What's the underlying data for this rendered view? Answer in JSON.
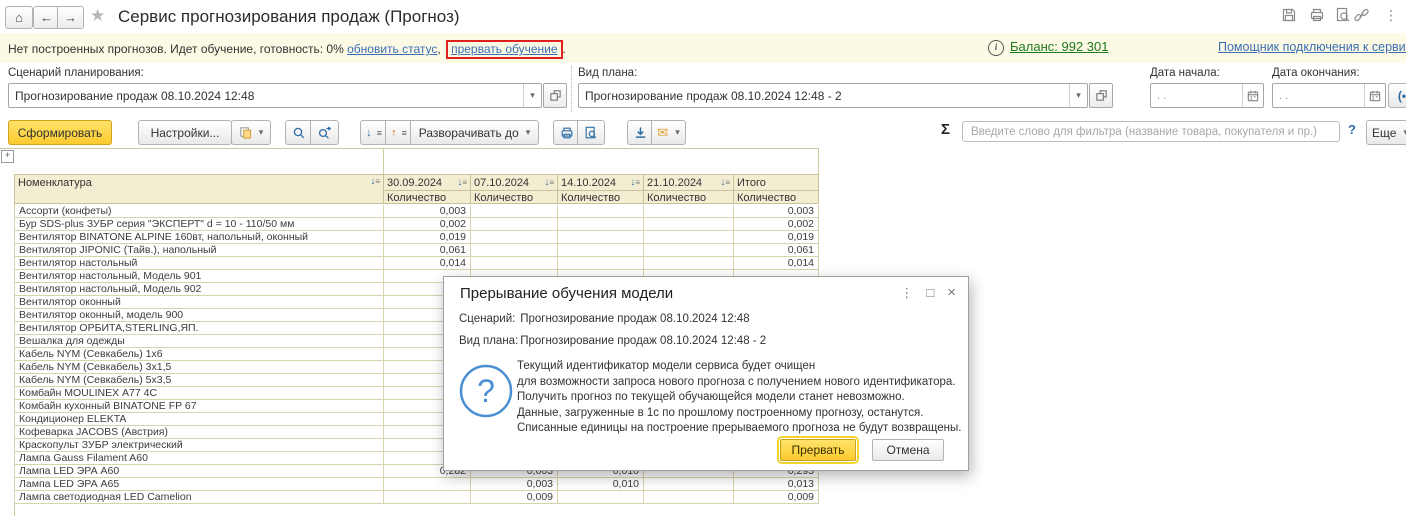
{
  "topbar": {
    "title": "Сервис прогнозирования продаж (Прогноз)"
  },
  "icons": {
    "home": "⌂",
    "back": "←",
    "forward": "→",
    "favorite_star": "★",
    "menu_kebab": "⋮",
    "window_maximize": "□",
    "window_close": "×",
    "dropdown": "▾",
    "sigma": "Σ",
    "info": "i",
    "sort_arrow": "↓",
    "sort_lines": "≡",
    "collapse_arrow": "↓",
    "expand_arrow": "↑",
    "corner_plus": "+",
    "period": "(•)",
    "envelope": "✉"
  },
  "notification": {
    "status_text": "Нет построенных прогнозов. Идет обучение, готовность: 0%",
    "refresh_link": "обновить статус",
    "comma": ",",
    "interrupt_link": "прервать обучение",
    "dot": ".",
    "balance_link": "Баланс: 992 301",
    "assistant_link": "Помощник подключения к сервису"
  },
  "filters": {
    "scenario_label": "Сценарий планирования:",
    "scenario_value": "Прогнозирование продаж 08.10.2024 12:48",
    "plan_label": "Вид плана:",
    "plan_value": "Прогнозирование продаж 08.10.2024 12:48 - 2",
    "date_start_label": "Дата начала:",
    "date_end_label": "Дата окончания:",
    "date_empty_value": ". ."
  },
  "toolbar": {
    "generate_label": "Сформировать",
    "settings_label": "Настройки...",
    "expand_to_label": "Разворачивать до",
    "filter_placeholder": "Введите слово для фильтра (название товара, покупателя и пр.)",
    "help_label": "?",
    "more_label": "Еще"
  },
  "table": {
    "name_header": "Номенклатура",
    "date_columns": [
      "30.09.2024",
      "07.10.2024",
      "14.10.2024",
      "21.10.2024"
    ],
    "total_header": "Итого",
    "measure_header": "Количество",
    "rows": [
      {
        "name": "Ассорти (конфеты)",
        "values": [
          "0,003",
          "",
          "",
          "",
          "0,003"
        ]
      },
      {
        "name": "Бур SDS-plus ЗУБР серия \"ЭКСПЕРТ\" d = 10 - 110/50 мм",
        "values": [
          "0,002",
          "",
          "",
          "",
          "0,002"
        ]
      },
      {
        "name": "Вентилятор BINATONE ALPINE 160вт, напольный, оконный",
        "values": [
          "0,019",
          "",
          "",
          "",
          "0,019"
        ]
      },
      {
        "name": "Вентилятор JIPONIC (Тайв.), напольный",
        "values": [
          "0,061",
          "",
          "",
          "",
          "0,061"
        ]
      },
      {
        "name": "Вентилятор настольный",
        "values": [
          "0,014",
          "",
          "",
          "",
          "0,014"
        ]
      },
      {
        "name": "Вентилятор настольный, Модель 901",
        "values": [
          "",
          "",
          "",
          "",
          ""
        ]
      },
      {
        "name": "Вентилятор настольный, Модель 902",
        "values": [
          "",
          "",
          "",
          "",
          ""
        ]
      },
      {
        "name": "Вентилятор оконный",
        "values": [
          "",
          "",
          "",
          "",
          ""
        ]
      },
      {
        "name": "Вентилятор оконный, модель 900",
        "values": [
          "",
          "",
          "",
          "",
          ""
        ]
      },
      {
        "name": "Вентилятор ОРБИТА,STERLING,ЯП.",
        "values": [
          "",
          "",
          "",
          "",
          ""
        ]
      },
      {
        "name": "Вешалка для одежды",
        "values": [
          "",
          "",
          "",
          "",
          ""
        ]
      },
      {
        "name": "Кабель NYM (Севкабель) 1х6",
        "values": [
          "",
          "",
          "",
          "",
          ""
        ]
      },
      {
        "name": "Кабель NYM (Севкабель) 3х1,5",
        "values": [
          "",
          "",
          "",
          "",
          ""
        ]
      },
      {
        "name": "Кабель NYM (Севкабель) 5х3,5",
        "values": [
          "",
          "",
          "",
          "",
          ""
        ]
      },
      {
        "name": "Комбайн MOULINEX  А77 4С",
        "values": [
          "",
          "",
          "",
          "",
          ""
        ]
      },
      {
        "name": "Комбайн кухонный BINATONE FP 67",
        "values": [
          "",
          "",
          "",
          "",
          ""
        ]
      },
      {
        "name": "Кондиционер ELEKTA",
        "values": [
          "",
          "",
          "",
          "",
          ""
        ]
      },
      {
        "name": "Кофеварка JACOBS (Австрия)",
        "values": [
          "",
          "",
          "",
          "",
          ""
        ]
      },
      {
        "name": "Краскопульт ЗУБР электрический",
        "values": [
          "",
          "",
          "",
          "",
          ""
        ]
      },
      {
        "name": "Лампа Gauss Filament A60",
        "values": [
          "",
          "",
          "",
          "",
          ""
        ]
      },
      {
        "name": "Лампа LED ЭРА А60",
        "values": [
          "0,282",
          "0,003",
          "0,010",
          "",
          "0,295"
        ]
      },
      {
        "name": "Лампа LED ЭРА А65",
        "values": [
          "",
          "0,003",
          "0,010",
          "",
          "0,013"
        ]
      },
      {
        "name": "Лампа светодиодная LED Camelion",
        "values": [
          "",
          "0,009",
          "",
          "",
          "0,009"
        ]
      }
    ]
  },
  "dialog": {
    "title": "Прерывание обучения модели",
    "scenario_label": "Сценарий:",
    "scenario_value": "Прогнозирование продаж 08.10.2024 12:48",
    "plan_label": "Вид плана:",
    "plan_value": "Прогнозирование продаж 08.10.2024 12:48 - 2",
    "message_lines": [
      "Текущий идентификатор модели сервиса будет очищен",
      "для возможности запроса нового прогноза с получением нового идентификатора.",
      "Получить прогноз по текущей обучающейся модели станет невозможно.",
      "Данные, загруженные в 1с по прошлому построенному прогнозу, останутся.",
      "Списанные единицы на построение прерываемого прогноза не будут возвращены."
    ],
    "confirm_label": "Прервать",
    "cancel_label": "Отмена"
  },
  "colors": {
    "accent_yellow": "#fcca2e",
    "link_blue": "#3a6fb5",
    "balance_green": "#1e7a1e",
    "annotation_red": "#dd2020",
    "header_beige": "#f3edd2",
    "notification_bg": "#fcf9e4",
    "table_border": "#cfc9a1"
  }
}
